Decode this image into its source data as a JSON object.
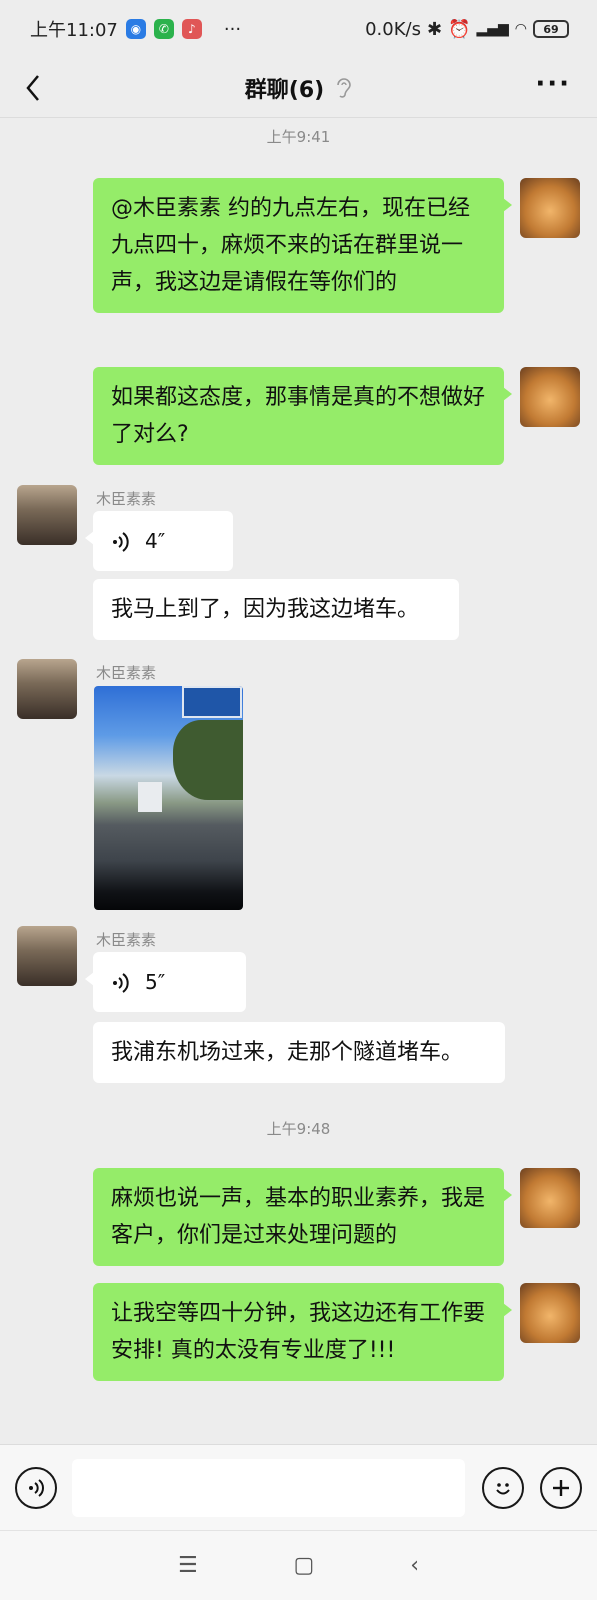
{
  "status_bar": {
    "time": "上午11:07",
    "network_speed": "0.0K/s",
    "battery": "69",
    "icons": [
      "bot-icon",
      "phone-icon",
      "mic-icon",
      "more-dots-icon",
      "bluetooth-icon",
      "alarm-icon",
      "signal-icon",
      "wifi-icon"
    ]
  },
  "header": {
    "title": "群聊(6)",
    "back_icon": "chevron-left-icon",
    "mute_icon": "ear-icon",
    "more_icon": "more-horizontal-icon"
  },
  "messages": [
    {
      "type": "timestamp",
      "text": "上午9:41"
    },
    {
      "type": "text",
      "from": "me",
      "text": "@木臣素素  约的九点左右，现在已经九点四十，麻烦不来的话在群里说一声，我这边是请假在等你们的"
    },
    {
      "type": "text",
      "from": "me",
      "text": "如果都这态度，那事情是真的不想做好了对么?"
    },
    {
      "type": "voice",
      "from": "other",
      "sender": "木臣素素",
      "duration": "4″"
    },
    {
      "type": "text",
      "from": "other",
      "text": "我马上到了，因为我这边堵车。"
    },
    {
      "type": "image",
      "from": "other",
      "sender": "木臣素素"
    },
    {
      "type": "voice",
      "from": "other",
      "sender": "木臣素素",
      "duration": "5″"
    },
    {
      "type": "text",
      "from": "other",
      "text": "我浦东机场过来，走那个隧道堵车。"
    },
    {
      "type": "timestamp",
      "text": "上午9:48"
    },
    {
      "type": "text",
      "from": "me",
      "text": "麻烦也说一声，基本的职业素养，我是客户，你们是过来处理问题的"
    },
    {
      "type": "text",
      "from": "me",
      "text": "让我空等四十分钟，我这边还有工作要安排! 真的太没有专业度了!!!"
    }
  ],
  "input_bar": {
    "voice_icon": "voice-mode-icon",
    "emoji_icon": "emoji-icon",
    "plus_icon": "plus-icon"
  },
  "colors": {
    "my_bubble": "#95ec69",
    "other_bubble": "#ffffff",
    "background": "#ededed"
  }
}
